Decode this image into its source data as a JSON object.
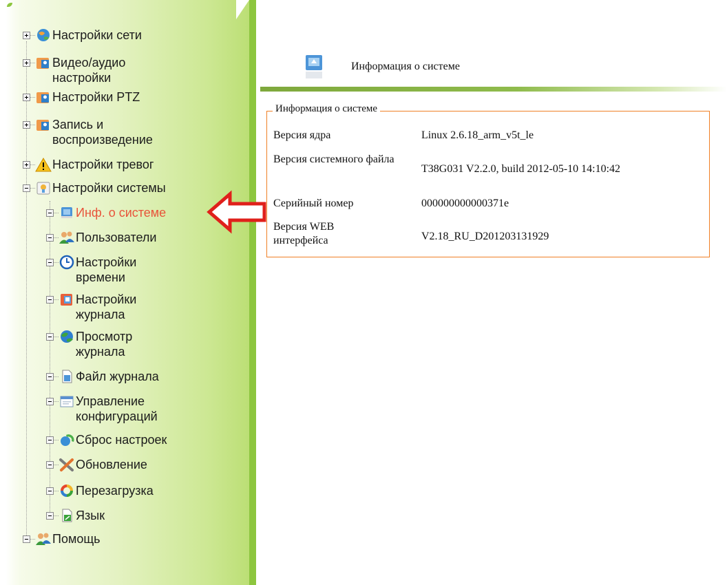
{
  "header": {
    "title": "Информация о системе"
  },
  "panel": {
    "legend": "Информация о системе",
    "rows": [
      {
        "label": "Версия ядра",
        "value": "Linux 2.6.18_arm_v5t_le"
      },
      {
        "label": "Версия системного файла",
        "value": "T38G031 V2.2.0, build 2012-05-10 14:10:42"
      },
      {
        "label": "Серийный номер",
        "value": "000000000000371e"
      },
      {
        "label": "Версия WEB интерфейса",
        "value": "V2.18_RU_D201203131929"
      }
    ]
  },
  "tree": {
    "items": [
      {
        "label": "Настройки сети",
        "icon": "network-icon"
      },
      {
        "label": "Видео/аудио настройки",
        "icon": "video-audio-icon"
      },
      {
        "label": "Настройки PTZ",
        "icon": "ptz-icon"
      },
      {
        "label": "Запись и воспроизведение",
        "icon": "record-icon"
      },
      {
        "label": "Настройки тревог",
        "icon": "alarm-warning-icon"
      },
      {
        "label": "Настройки системы",
        "icon": "system-settings-icon"
      },
      {
        "label": "Инф. о системе",
        "icon": "system-info-icon",
        "selected": true
      },
      {
        "label": "Пользователи",
        "icon": "users-icon"
      },
      {
        "label": "Настройки времени",
        "icon": "clock-icon"
      },
      {
        "label": "Настройки журнала",
        "icon": "log-settings-icon"
      },
      {
        "label": "Просмотр журнала",
        "icon": "log-view-globe-icon"
      },
      {
        "label": "Файл журнала",
        "icon": "log-file-icon"
      },
      {
        "label": "Управление конфигураций",
        "icon": "config-window-icon"
      },
      {
        "label": "Сброс настроек",
        "icon": "reset-icon"
      },
      {
        "label": "Обновление",
        "icon": "update-tools-icon"
      },
      {
        "label": "Перезагрузка",
        "icon": "reboot-icon"
      },
      {
        "label": "Язык",
        "icon": "language-icon"
      },
      {
        "label": "Помощь",
        "icon": "help-users-icon"
      }
    ]
  },
  "colors": {
    "sidebar_green": "#8dc63f",
    "selected_text": "#e8543a",
    "fieldset_border": "#f07f24",
    "annotation_arrow": "#e0201b"
  }
}
